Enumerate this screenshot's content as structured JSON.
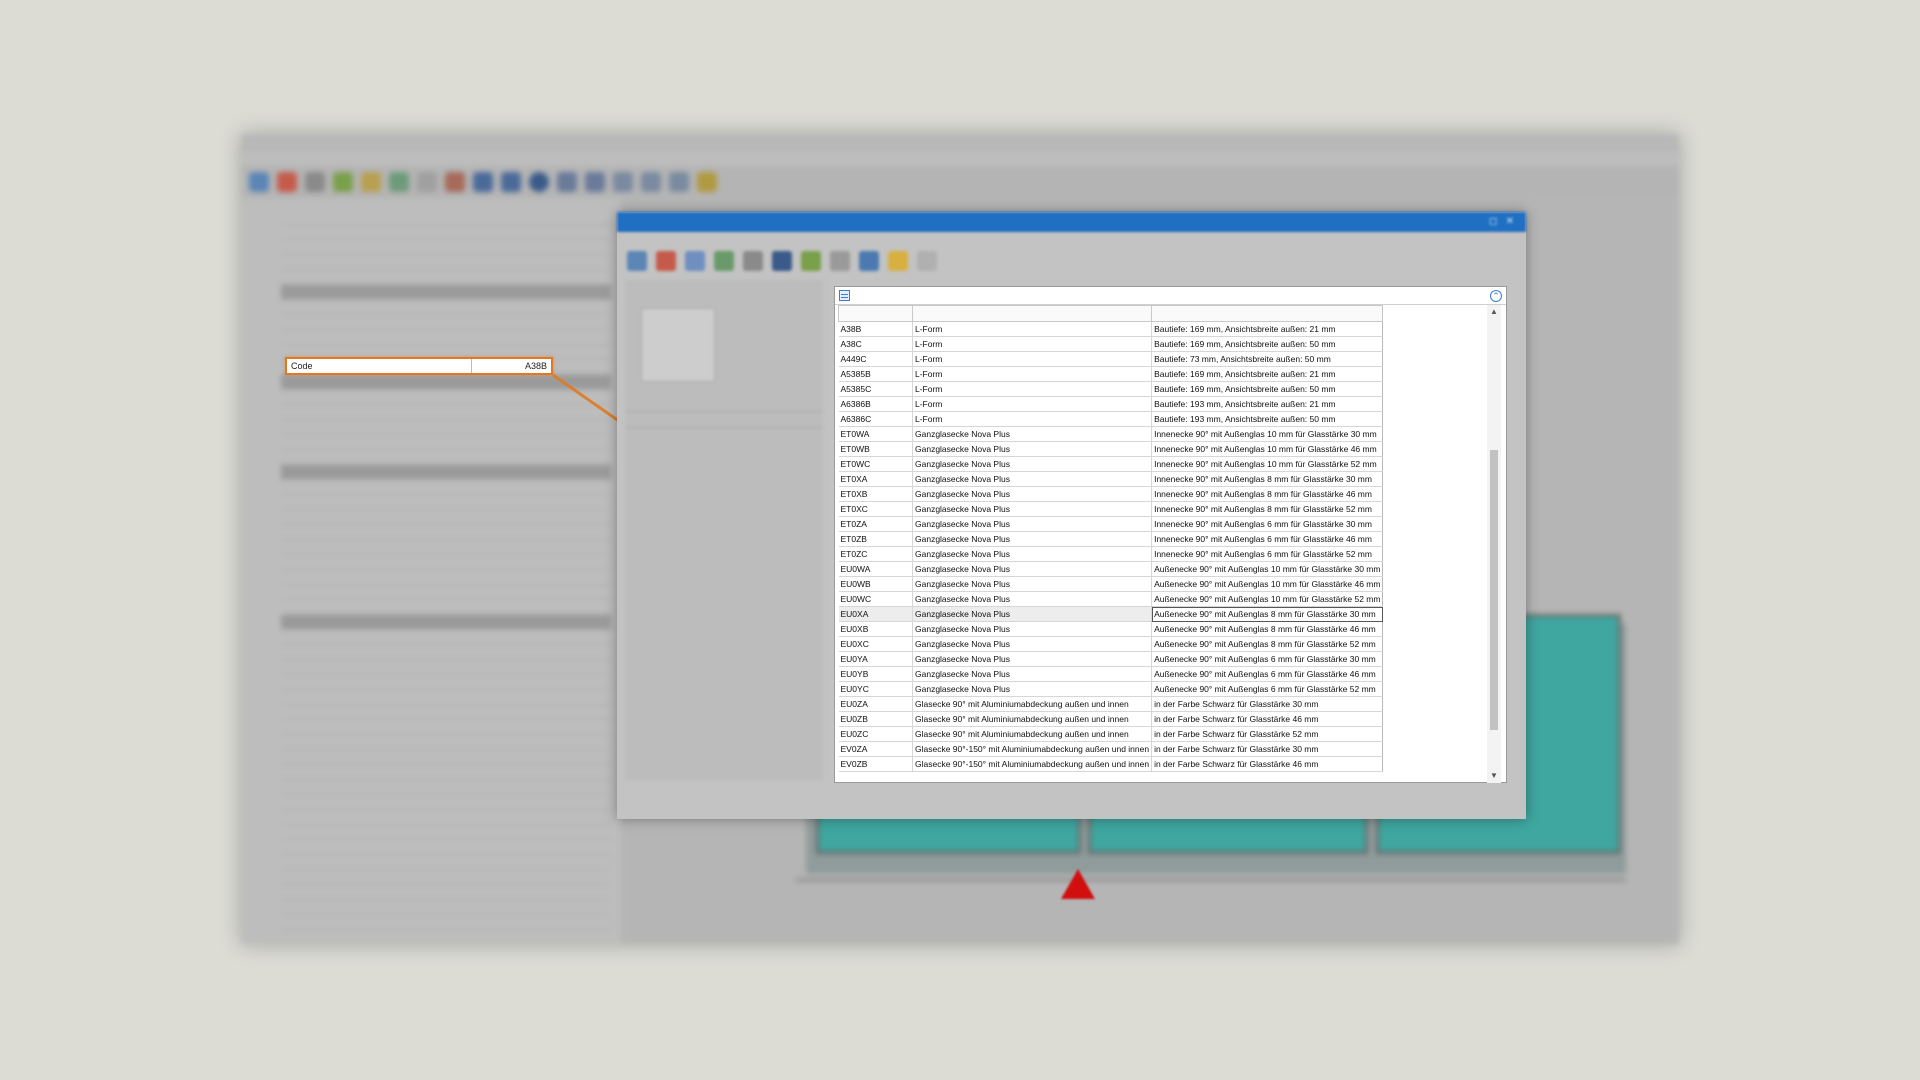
{
  "lookup_table": {
    "columns": [
      "",
      "",
      ""
    ],
    "rows": [
      {
        "code": "A38B",
        "form": "L-Form",
        "desc": "Bautiefe: 169 mm, Ansichtsbreite außen: 21 mm"
      },
      {
        "code": "A38C",
        "form": "L-Form",
        "desc": "Bautiefe: 169 mm, Ansichtsbreite außen: 50 mm"
      },
      {
        "code": "A449C",
        "form": "L-Form",
        "desc": "Bautiefe: 73 mm, Ansichtsbreite außen: 50 mm"
      },
      {
        "code": "A5385B",
        "form": "L-Form",
        "desc": "Bautiefe: 169 mm, Ansichtsbreite außen: 21 mm"
      },
      {
        "code": "A5385C",
        "form": "L-Form",
        "desc": "Bautiefe: 169 mm, Ansichtsbreite außen: 50 mm"
      },
      {
        "code": "A6386B",
        "form": "L-Form",
        "desc": "Bautiefe: 193 mm, Ansichtsbreite außen: 21 mm"
      },
      {
        "code": "A6386C",
        "form": "L-Form",
        "desc": "Bautiefe: 193 mm, Ansichtsbreite außen: 50 mm"
      },
      {
        "code": "ET0WA",
        "form": "Ganzglasecke Nova Plus",
        "desc": "Innenecke 90° mit Außenglas 10 mm für Glasstärke 30 mm"
      },
      {
        "code": "ET0WB",
        "form": "Ganzglasecke Nova Plus",
        "desc": "Innenecke 90° mit Außenglas 10 mm für Glasstärke 46 mm"
      },
      {
        "code": "ET0WC",
        "form": "Ganzglasecke Nova Plus",
        "desc": "Innenecke 90° mit Außenglas 10 mm für Glasstärke 52 mm"
      },
      {
        "code": "ET0XA",
        "form": "Ganzglasecke Nova Plus",
        "desc": "Innenecke 90° mit Außenglas 8 mm für Glasstärke 30 mm"
      },
      {
        "code": "ET0XB",
        "form": "Ganzglasecke Nova Plus",
        "desc": "Innenecke 90° mit Außenglas 8 mm für Glasstärke 46 mm"
      },
      {
        "code": "ET0XC",
        "form": "Ganzglasecke Nova Plus",
        "desc": "Innenecke 90° mit Außenglas 8 mm für Glasstärke 52 mm"
      },
      {
        "code": "ET0ZA",
        "form": "Ganzglasecke Nova Plus",
        "desc": "Innenecke 90° mit Außenglas 6 mm für Glasstärke 30 mm"
      },
      {
        "code": "ET0ZB",
        "form": "Ganzglasecke Nova Plus",
        "desc": "Innenecke 90° mit Außenglas 6 mm für Glasstärke 46 mm"
      },
      {
        "code": "ET0ZC",
        "form": "Ganzglasecke Nova Plus",
        "desc": "Innenecke 90° mit Außenglas 6 mm für Glasstärke 52 mm"
      },
      {
        "code": "EU0WA",
        "form": "Ganzglasecke Nova Plus",
        "desc": "Außenecke 90° mit Außenglas 10 mm für Glasstärke 30 mm"
      },
      {
        "code": "EU0WB",
        "form": "Ganzglasecke Nova Plus",
        "desc": "Außenecke 90° mit Außenglas 10 mm für Glasstärke 46 mm"
      },
      {
        "code": "EU0WC",
        "form": "Ganzglasecke Nova Plus",
        "desc": "Außenecke 90° mit Außenglas 10 mm für Glasstärke 52 mm"
      },
      {
        "code": "EU0XA",
        "form": "Ganzglasecke Nova Plus",
        "desc": "Außenecke 90° mit Außenglas 8 mm für Glasstärke 30 mm"
      },
      {
        "code": "EU0XB",
        "form": "Ganzglasecke Nova Plus",
        "desc": "Außenecke 90° mit Außenglas 8 mm für Glasstärke 46 mm"
      },
      {
        "code": "EU0XC",
        "form": "Ganzglasecke Nova Plus",
        "desc": "Außenecke 90° mit Außenglas 8 mm für Glasstärke 52 mm"
      },
      {
        "code": "EU0YA",
        "form": "Ganzglasecke Nova Plus",
        "desc": "Außenecke 90° mit Außenglas 6 mm für Glasstärke 30 mm"
      },
      {
        "code": "EU0YB",
        "form": "Ganzglasecke Nova Plus",
        "desc": "Außenecke 90° mit Außenglas 6 mm für Glasstärke 46 mm"
      },
      {
        "code": "EU0YC",
        "form": "Ganzglasecke Nova Plus",
        "desc": "Außenecke 90° mit Außenglas 6 mm für Glasstärke 52 mm"
      },
      {
        "code": "EU0ZA",
        "form": "Glasecke 90° mit Aluminiumabdeckung außen und innen",
        "desc": "in der Farbe Schwarz für Glasstärke 30 mm"
      },
      {
        "code": "EU0ZB",
        "form": "Glasecke 90° mit Aluminiumabdeckung außen und innen",
        "desc": "in der Farbe Schwarz für Glasstärke 46 mm"
      },
      {
        "code": "EU0ZC",
        "form": "Glasecke 90° mit Aluminiumabdeckung außen und innen",
        "desc": "in der Farbe Schwarz für Glasstärke 52 mm"
      },
      {
        "code": "EV0ZA",
        "form": "Glasecke 90°-150° mit Aluminiumabdeckung außen und innen",
        "desc": "in der Farbe Schwarz für Glasstärke 30 mm"
      },
      {
        "code": "EV0ZB",
        "form": "Glasecke 90°-150° mit Aluminiumabdeckung außen und innen",
        "desc": "in der Farbe Schwarz für Glasstärke 46 mm"
      }
    ],
    "selected_index": 19
  },
  "callout": {
    "label": "Code",
    "value": "A38B"
  },
  "colors": {
    "accent": "#e07a22",
    "dialog_title": "#1f6fc2",
    "glass": "#3fa6a0",
    "marker": "#d10f0f"
  }
}
